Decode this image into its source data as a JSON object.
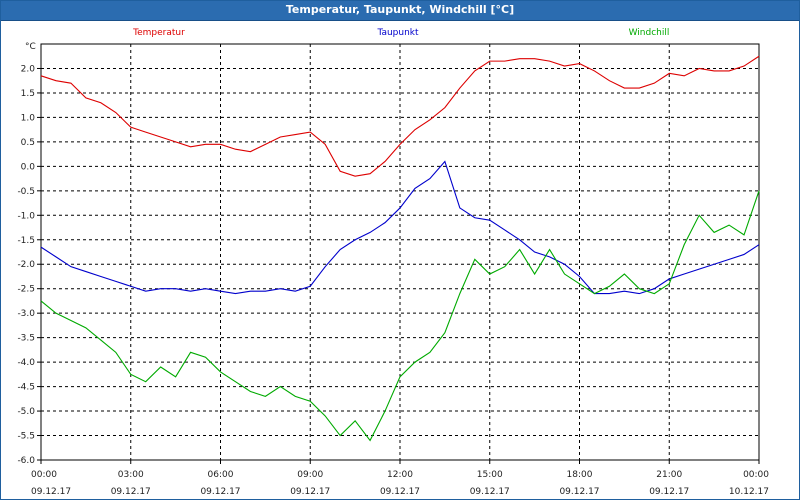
{
  "window": {
    "title": "Temperatur, Taupunkt, Windchill [°C]"
  },
  "chart_data": {
    "type": "line",
    "title": "Temperatur, Taupunkt, Windchill [°C]",
    "ylabel": "°C",
    "ylim": [
      -6.0,
      2.5
    ],
    "xlim": [
      "2017-12-09 00:00",
      "2017-12-10 00:00"
    ],
    "grid": true,
    "legend_position": "top",
    "x_tick_labels": [
      {
        "time": "00:00",
        "date": "09.12.17"
      },
      {
        "time": "03:00",
        "date": "09.12.17"
      },
      {
        "time": "06:00",
        "date": "09.12.17"
      },
      {
        "time": "09:00",
        "date": "09.12.17"
      },
      {
        "time": "12:00",
        "date": "09.12.17"
      },
      {
        "time": "15:00",
        "date": "09.12.17"
      },
      {
        "time": "18:00",
        "date": "09.12.17"
      },
      {
        "time": "21:00",
        "date": "09.12.17"
      },
      {
        "time": "00:00",
        "date": "10.12.17"
      }
    ],
    "y_tick_labels": [
      "2.0",
      "1.5",
      "1.0",
      "0.5",
      "0.0",
      "-0.5",
      "-1.0",
      "-1.5",
      "-2.0",
      "-2.5",
      "-3.0",
      "-3.5",
      "-4.0",
      "-4.5",
      "-5.0",
      "-5.5",
      "-6.0"
    ],
    "x_hours": [
      0,
      0.5,
      1,
      1.5,
      2,
      2.5,
      3,
      3.5,
      4,
      4.5,
      5,
      5.5,
      6,
      6.5,
      7,
      7.5,
      8,
      8.5,
      9,
      9.5,
      10,
      10.5,
      11,
      11.5,
      12,
      12.5,
      13,
      13.5,
      14,
      14.5,
      15,
      15.5,
      16,
      16.5,
      17,
      17.5,
      18,
      18.5,
      19,
      19.5,
      20,
      20.5,
      21,
      21.5,
      22,
      22.5,
      23,
      23.5,
      24
    ],
    "series": [
      {
        "name": "Temperatur",
        "color": "#dd0000",
        "values": [
          1.85,
          1.75,
          1.7,
          1.4,
          1.3,
          1.1,
          0.8,
          0.7,
          0.6,
          0.5,
          0.4,
          0.45,
          0.45,
          0.35,
          0.3,
          0.45,
          0.6,
          0.65,
          0.7,
          0.45,
          -0.1,
          -0.2,
          -0.15,
          0.1,
          0.45,
          0.75,
          0.95,
          1.2,
          1.6,
          1.95,
          2.15,
          2.15,
          2.2,
          2.2,
          2.15,
          2.05,
          2.1,
          1.95,
          1.75,
          1.6,
          1.6,
          1.7,
          1.9,
          1.85,
          2.0,
          1.95,
          1.95,
          2.05,
          2.25
        ]
      },
      {
        "name": "Taupunkt",
        "color": "#0000cc",
        "values": [
          -1.65,
          -1.85,
          -2.05,
          -2.15,
          -2.25,
          -2.35,
          -2.45,
          -2.55,
          -2.5,
          -2.5,
          -2.55,
          -2.5,
          -2.55,
          -2.6,
          -2.55,
          -2.55,
          -2.5,
          -2.55,
          -2.45,
          -2.05,
          -1.7,
          -1.5,
          -1.35,
          -1.15,
          -0.85,
          -0.45,
          -0.25,
          0.1,
          -0.85,
          -1.05,
          -1.1,
          -1.3,
          -1.5,
          -1.75,
          -1.85,
          -2.0,
          -2.25,
          -2.6,
          -2.6,
          -2.55,
          -2.6,
          -2.5,
          -2.3,
          -2.2,
          -2.1,
          -2.0,
          -1.9,
          -1.8,
          -1.6
        ]
      },
      {
        "name": "Windchill",
        "color": "#00aa00",
        "values": [
          -2.75,
          -3.0,
          -3.15,
          -3.3,
          -3.55,
          -3.8,
          -4.25,
          -4.4,
          -4.1,
          -4.3,
          -3.8,
          -3.9,
          -4.2,
          -4.4,
          -4.6,
          -4.7,
          -4.5,
          -4.7,
          -4.8,
          -5.1,
          -5.5,
          -5.2,
          -5.6,
          -5.0,
          -4.3,
          -4.0,
          -3.8,
          -3.4,
          -2.6,
          -1.9,
          -2.2,
          -2.05,
          -1.7,
          -2.2,
          -1.7,
          -2.2,
          -2.4,
          -2.6,
          -2.45,
          -2.2,
          -2.5,
          -2.6,
          -2.4,
          -1.6,
          -1.0,
          -1.35,
          -1.2,
          -1.4,
          -0.5
        ]
      }
    ]
  }
}
